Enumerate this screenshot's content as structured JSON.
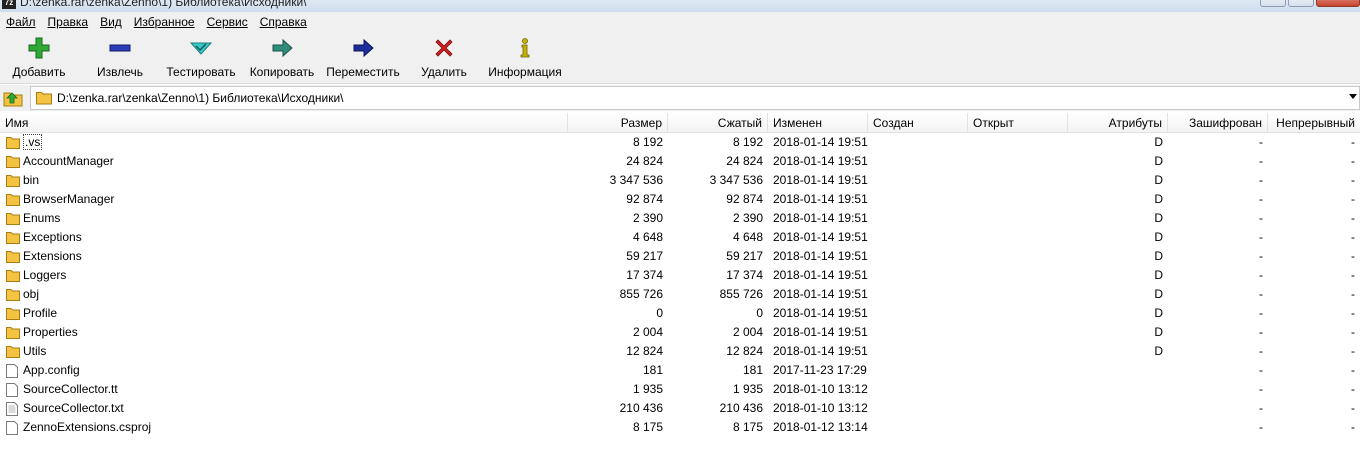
{
  "window": {
    "title": "D:\\zenka.rar\\zenka\\Zenno\\1) Библиотека\\Исходники\\",
    "app_icon_text": "7z"
  },
  "menu": [
    {
      "label": "Файл",
      "name": "menu-file"
    },
    {
      "label": "Правка",
      "name": "menu-edit"
    },
    {
      "label": "Вид",
      "name": "menu-view"
    },
    {
      "label": "Избранное",
      "name": "menu-favorites"
    },
    {
      "label": "Сервис",
      "name": "menu-tools"
    },
    {
      "label": "Справка",
      "name": "menu-help"
    }
  ],
  "toolbar": {
    "add": "Добавить",
    "extract": "Извлечь",
    "test": "Тестировать",
    "copy": "Копировать",
    "move": "Переместить",
    "delete": "Удалить",
    "info": "Информация"
  },
  "address": {
    "path": "D:\\zenka.rar\\zenka\\Zenno\\1) Библиотека\\Исходники\\"
  },
  "columns": {
    "name": "Имя",
    "size": "Размер",
    "packed": "Сжатый",
    "modified": "Изменен",
    "created": "Создан",
    "accessed": "Открыт",
    "attributes": "Атрибуты",
    "encrypted": "Зашифрован",
    "solid": "Непрерывный"
  },
  "rows": [
    {
      "type": "folder",
      "name": ".vs",
      "size": "8 192",
      "packed": "8 192",
      "modified": "2018-01-14 19:51",
      "attributes": "D",
      "encrypted": "-",
      "solid": "-"
    },
    {
      "type": "folder",
      "name": "AccountManager",
      "size": "24 824",
      "packed": "24 824",
      "modified": "2018-01-14 19:51",
      "attributes": "D",
      "encrypted": "-",
      "solid": "-"
    },
    {
      "type": "folder",
      "name": "bin",
      "size": "3 347 536",
      "packed": "3 347 536",
      "modified": "2018-01-14 19:51",
      "attributes": "D",
      "encrypted": "-",
      "solid": "-"
    },
    {
      "type": "folder",
      "name": "BrowserManager",
      "size": "92 874",
      "packed": "92 874",
      "modified": "2018-01-14 19:51",
      "attributes": "D",
      "encrypted": "-",
      "solid": "-"
    },
    {
      "type": "folder",
      "name": "Enums",
      "size": "2 390",
      "packed": "2 390",
      "modified": "2018-01-14 19:51",
      "attributes": "D",
      "encrypted": "-",
      "solid": "-"
    },
    {
      "type": "folder",
      "name": "Exceptions",
      "size": "4 648",
      "packed": "4 648",
      "modified": "2018-01-14 19:51",
      "attributes": "D",
      "encrypted": "-",
      "solid": "-"
    },
    {
      "type": "folder",
      "name": "Extensions",
      "size": "59 217",
      "packed": "59 217",
      "modified": "2018-01-14 19:51",
      "attributes": "D",
      "encrypted": "-",
      "solid": "-"
    },
    {
      "type": "folder",
      "name": "Loggers",
      "size": "17 374",
      "packed": "17 374",
      "modified": "2018-01-14 19:51",
      "attributes": "D",
      "encrypted": "-",
      "solid": "-"
    },
    {
      "type": "folder",
      "name": "obj",
      "size": "855 726",
      "packed": "855 726",
      "modified": "2018-01-14 19:51",
      "attributes": "D",
      "encrypted": "-",
      "solid": "-"
    },
    {
      "type": "folder",
      "name": "Profile",
      "size": "0",
      "packed": "0",
      "modified": "2018-01-14 19:51",
      "attributes": "D",
      "encrypted": "-",
      "solid": "-"
    },
    {
      "type": "folder",
      "name": "Properties",
      "size": "2 004",
      "packed": "2 004",
      "modified": "2018-01-14 19:51",
      "attributes": "D",
      "encrypted": "-",
      "solid": "-"
    },
    {
      "type": "folder",
      "name": "Utils",
      "size": "12 824",
      "packed": "12 824",
      "modified": "2018-01-14 19:51",
      "attributes": "D",
      "encrypted": "-",
      "solid": "-"
    },
    {
      "type": "file",
      "name": "App.config",
      "size": "181",
      "packed": "181",
      "modified": "2017-11-23 17:29",
      "attributes": "",
      "encrypted": "-",
      "solid": "-"
    },
    {
      "type": "file",
      "name": "SourceCollector.tt",
      "size": "1 935",
      "packed": "1 935",
      "modified": "2018-01-10 13:12",
      "attributes": "",
      "encrypted": "-",
      "solid": "-"
    },
    {
      "type": "file-text",
      "name": "SourceCollector.txt",
      "size": "210 436",
      "packed": "210 436",
      "modified": "2018-01-10 13:12",
      "attributes": "",
      "encrypted": "-",
      "solid": "-"
    },
    {
      "type": "file",
      "name": "ZennoExtensions.csproj",
      "size": "8 175",
      "packed": "8 175",
      "modified": "2018-01-12 13:14",
      "attributes": "",
      "encrypted": "-",
      "solid": "-"
    }
  ],
  "colors": {
    "folder": "#f5c342",
    "add_icon": "#2fa836",
    "extract_icon": "#2a3fb8",
    "test_icon": "#3cc7c7",
    "copy_icon": "#2f8c7a",
    "move_icon": "#1d2f9a",
    "delete_icon": "#d42020",
    "info_icon": "#c8b400"
  }
}
